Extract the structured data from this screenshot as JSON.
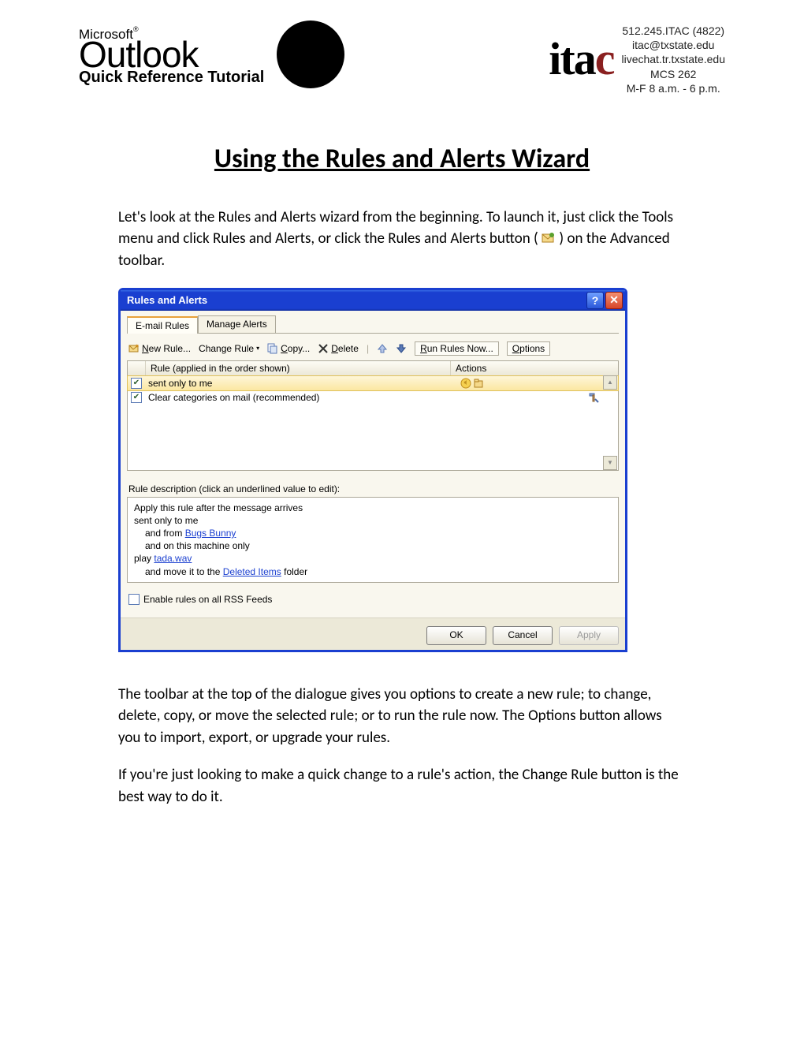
{
  "header": {
    "microsoft": "Microsoft",
    "outlook": "Outlook",
    "subtitle": "Quick Reference Tutorial",
    "itac_logo_black": "ita",
    "itac_logo_red": "c",
    "contact": {
      "phone": "512.245.ITAC (4822)",
      "email": "itac@txstate.edu",
      "chat": "livechat.tr.txstate.edu",
      "room": "MCS 262",
      "hours": "M-F 8 a.m. - 6 p.m."
    }
  },
  "title": "Using the Rules and Alerts Wizard",
  "intro_part1": "Let's look at the Rules and Alerts wizard from the beginning. To launch it, just click the Tools menu and click Rules and Alerts, or click the Rules and Alerts button (",
  "intro_part2": ") on the Advanced toolbar.",
  "dialog": {
    "title": "Rules and Alerts",
    "tabs": {
      "email_rules": "E-mail Rules",
      "manage_alerts": "Manage Alerts"
    },
    "toolbar": {
      "new_rule_u": "N",
      "new_rule": "ew Rule...",
      "change_rule": "Change Rule",
      "copy_u": "C",
      "copy": "opy...",
      "delete_u": "D",
      "delete": "elete",
      "run_u": "R",
      "run": "un Rules Now...",
      "options_u": "O",
      "options": "ptions"
    },
    "headers": {
      "rule": "Rule (applied in the order shown)",
      "actions": "Actions"
    },
    "rows": [
      {
        "checked": true,
        "selected": true,
        "name": "sent only to me",
        "action_icons": [
          "sound",
          "move"
        ]
      },
      {
        "checked": true,
        "selected": false,
        "name": "Clear categories on mail (recommended)",
        "action_icons": [
          "hammer"
        ]
      }
    ],
    "desc_label": "Rule description (click an underlined value to edit):",
    "desc": {
      "l1": "Apply this rule after the message arrives",
      "l2": "sent only to me",
      "l3a": "and from ",
      "l3link": "Bugs Bunny",
      "l4": "and on this machine only",
      "l5a": "play ",
      "l5link": "tada.wav",
      "l6a": "and move it to the ",
      "l6link": "Deleted Items",
      "l6b": " folder"
    },
    "rss": "Enable rules on all RSS Feeds",
    "buttons": {
      "ok": "OK",
      "cancel": "Cancel",
      "apply": "Apply"
    }
  },
  "para2": "The toolbar at the top of the dialogue gives you options to create a new rule; to change, delete, copy, or move the selected rule; or to run the rule now. The Options button allows you to import, export, or upgrade your rules.",
  "para3": "If you're just looking to make a quick change to a rule's action, the Change Rule button is the best way to do it."
}
